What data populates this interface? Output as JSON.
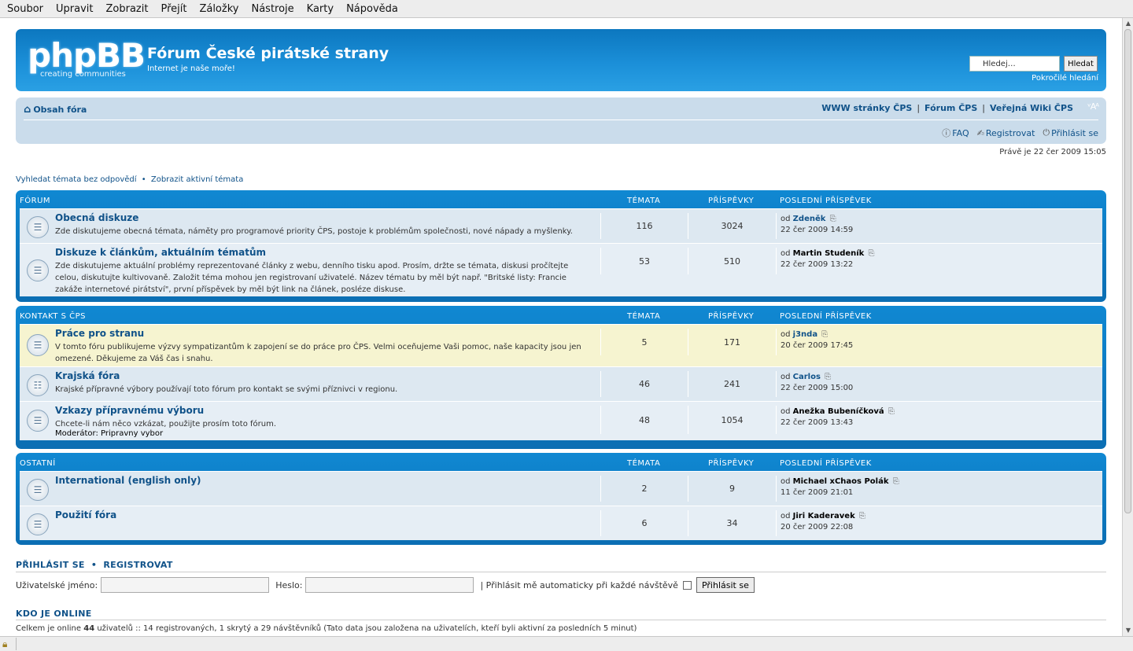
{
  "menu": [
    "Soubor",
    "Upravit",
    "Zobrazit",
    "Přejít",
    "Záložky",
    "Nástroje",
    "Karty",
    "Nápověda"
  ],
  "header": {
    "logo_text": "phpBB",
    "logo_tagline": "creating  communities",
    "title": "Fórum České pirátské strany",
    "description": "Internet je naše moře!",
    "search_placeholder": "Hledej…",
    "search_button": "Hledat",
    "advanced_search": "Pokročilé hledání"
  },
  "navbar": {
    "home": "Obsah fóra",
    "links": [
      "WWW stránky ČPS",
      "Fórum ČPS",
      "Veřejná Wiki ČPS"
    ],
    "font_size": "ᵛAᴬ",
    "faq": "FAQ",
    "register": "Registrovat",
    "login": "Přihlásit se"
  },
  "datetime": "Právě je 22 čer 2009 15:05",
  "quick_links": {
    "unanswered": "Vyhledat témata bez odpovědí",
    "active": "Zobrazit aktivní témata",
    "separator": "•"
  },
  "columns": {
    "topics": "TÉMATA",
    "posts": "PŘÍSPĚVKY",
    "last_post": "POSLEDNÍ PŘÍSPĚVEK"
  },
  "categories": [
    {
      "name": "FÓRUM",
      "forums": [
        {
          "title": "Obecná diskuze",
          "desc": "Zde diskutujeme obecná témata, náměty pro programové priority ČPS, postoje k problémům společnosti, nové nápady a myšlenky.",
          "topics": "116",
          "posts": "3024",
          "by_prefix": "od",
          "author": "Zdeněk",
          "time": "22 čer 2009 14:59"
        },
        {
          "title": "Diskuze k článkům, aktuálním tématům",
          "desc": "Zde diskutujeme aktuální problémy reprezentované články z webu, denního tisku apod. Prosím, držte se témata, diskusi pročítejte celou, diskutujte kultivovaně. Založit téma mohou jen registrovaní uživatelé. Název tématu by měl být např. \"Britské listy: Francie zakáže internetové pirátství\", první příspěvek by měl být link na článek, posléze diskuse.",
          "topics": "53",
          "posts": "510",
          "by_prefix": "od",
          "author": "Martin Studeník",
          "time": "22 čer 2009 13:22"
        }
      ]
    },
    {
      "name": "KONTAKT S ČPS",
      "forums": [
        {
          "title": "Práce pro stranu",
          "desc": "V tomto fóru publikujeme výzvy sympatizantům k zapojení se do práce pro ČPS. Velmi oceňujeme Vaši pomoc, naše kapacity jsou jen omezené. Děkujeme za Váš čas i snahu.",
          "topics": "5",
          "posts": "171",
          "by_prefix": "od",
          "author": "j3nda",
          "time": "20 čer 2009 17:45"
        },
        {
          "title": "Krajská fóra",
          "desc": "Krajské přípravné výbory používají toto fórum pro kontakt se svými příznivci v regionu.",
          "topics": "46",
          "posts": "241",
          "by_prefix": "od",
          "author": "Carlos",
          "time": "22 čer 2009 15:00"
        },
        {
          "title": "Vzkazy přípravnému výboru",
          "desc": "Chcete-li nám něco vzkázat, použijte prosím toto fórum.",
          "moderator": "Moderátor: Pripravny vybor",
          "topics": "48",
          "posts": "1054",
          "by_prefix": "od",
          "author": "Anežka Bubeníčková",
          "time": "22 čer 2009 13:43"
        }
      ]
    },
    {
      "name": "OSTATNÍ",
      "forums": [
        {
          "title": "International (english only)",
          "desc": "",
          "topics": "2",
          "posts": "9",
          "by_prefix": "od",
          "author": "Michael xChaos Polák",
          "time": "11 čer 2009 21:01"
        },
        {
          "title": "Použití fóra",
          "desc": "",
          "topics": "6",
          "posts": "34",
          "by_prefix": "od",
          "author": "Jiri Kaderavek",
          "time": "20 čer 2009 22:08"
        }
      ]
    }
  ],
  "login": {
    "title_login": "PŘIHLÁSIT SE",
    "title_sep": "•",
    "title_register": "REGISTROVAT",
    "username_label": "Uživatelské jméno:",
    "password_label": "Heslo:",
    "autologin_label": "| Přihlásit mě automaticky při každé návštěvě",
    "button": "Přihlásit se"
  },
  "online": {
    "title": "KDO JE ONLINE",
    "text_before": "Celkem je online",
    "count": "44",
    "text_after": "uživatelů :: 14 registrovaných, 1 skrytý a 29 návštěvníků (Tato data jsou založena na uživatelích, kteří byli aktivní za posledních 5 minut)"
  }
}
